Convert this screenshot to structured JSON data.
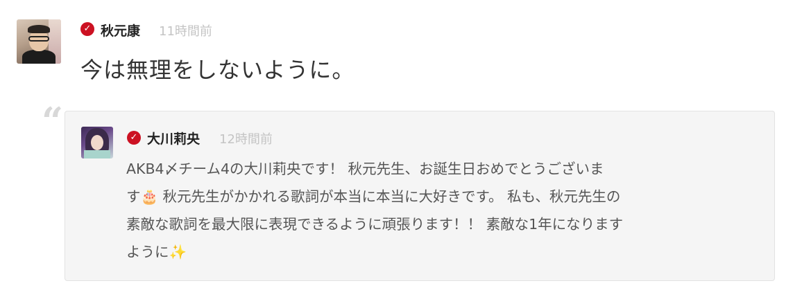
{
  "post": {
    "author": "秋元康",
    "time": "11時間前",
    "body": "今は無理をしないように。",
    "avatar_icon": "user-avatar-photo",
    "verified_icon": "verified-check-icon",
    "verified_color": "#cc1122"
  },
  "quoted": {
    "author": "大川莉央",
    "time": "12時間前",
    "avatar_icon": "user-avatar-photo",
    "verified_icon": "verified-check-icon",
    "quote_icon": "quote-mark-icon",
    "lines": [
      "AKB4〆チーム4の大川莉央です！ 秋元先生、お誕生日おめでとうございま",
      "す🎂   秋元先生がかかれる歌詞が本当に本当に大好きです。 私も、秋元先生の",
      "素敵な歌詞を最大限に表現できるように頑張ります！！ 素敵な1年になります",
      "ように✨"
    ]
  }
}
